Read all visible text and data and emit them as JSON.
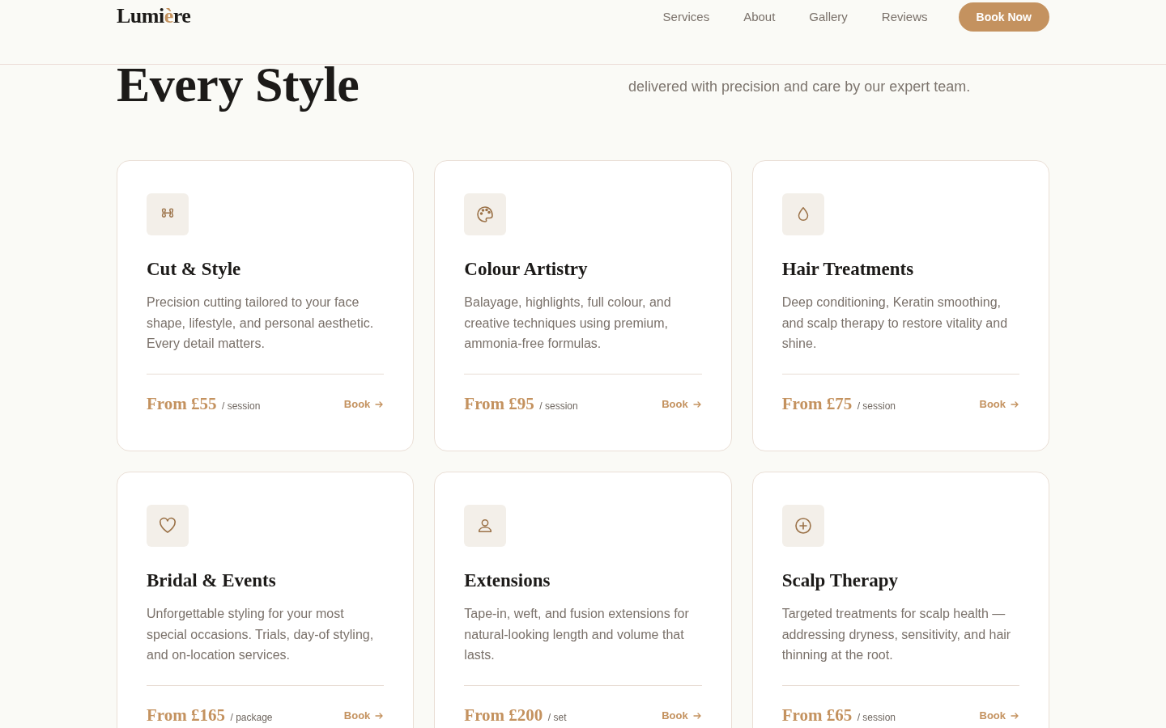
{
  "header": {
    "logo": {
      "before": "Lumi",
      "accent": "è",
      "after": "re"
    },
    "nav": [
      {
        "label": "Services"
      },
      {
        "label": "About"
      },
      {
        "label": "Gallery"
      },
      {
        "label": "Reviews"
      }
    ],
    "cta": "Book Now"
  },
  "hero": {
    "heading": "Every Style",
    "description": "delivered with precision and care by our expert team."
  },
  "services": [
    {
      "title": "Cut & Style",
      "description": "Precision cutting tailored to your face shape, lifestyle, and personal aesthetic. Every detail matters.",
      "price": "From £55",
      "unit": "/ session",
      "action": "Book"
    },
    {
      "title": "Colour Artistry",
      "description": "Balayage, highlights, full colour, and creative techniques using premium, ammonia-free formulas.",
      "price": "From £95",
      "unit": "/ session",
      "action": "Book"
    },
    {
      "title": "Hair Treatments",
      "description": "Deep conditioning, Keratin smoothing, and scalp therapy to restore vitality and shine.",
      "price": "From £75",
      "unit": "/ session",
      "action": "Book"
    },
    {
      "title": "Bridal & Events",
      "description": "Unforgettable styling for your most special occasions. Trials, day-of styling, and on-location services.",
      "price": "From £165",
      "unit": "/ package",
      "action": "Book"
    },
    {
      "title": "Extensions",
      "description": "Tape-in, weft, and fusion extensions for natural-looking length and volume that lasts.",
      "price": "From £200",
      "unit": "/ set",
      "action": "Book"
    },
    {
      "title": "Scalp Therapy",
      "description": "Targeted treatments for scalp health — addressing dryness, sensitivity, and hair thinning at the root.",
      "price": "From £65",
      "unit": "/ session",
      "action": "Book"
    }
  ]
}
